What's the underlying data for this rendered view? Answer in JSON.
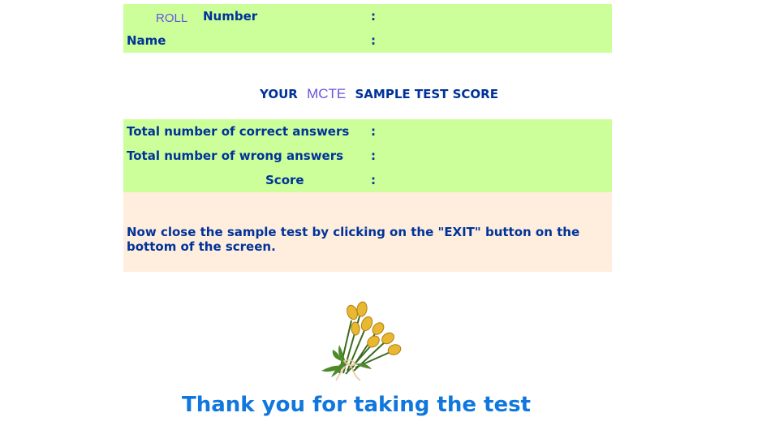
{
  "student_info": {
    "roll_word": "ROLL",
    "number_label": "Number",
    "name_label": "Name",
    "separator": ":"
  },
  "title": {
    "prefix": "YOUR",
    "exam": "MCTE",
    "suffix": "SAMPLE TEST SCORE"
  },
  "score_table": {
    "correct_label": "Total number of correct answers",
    "wrong_label": "Total number of wrong answers",
    "score_label": "Score",
    "separator": ":"
  },
  "message": "Now close the sample test by clicking on the \"EXIT\" button on the bottom of the screen.",
  "thanks": "Thank you for taking the test",
  "colors": {
    "panel_green": "#ccff99",
    "panel_peach": "#ffeedd",
    "label_text": "#003399",
    "accent_purple": "#6655dd",
    "thanks_blue": "#1177dd"
  },
  "icons": {
    "flower": "tulip-bouquet-icon"
  }
}
